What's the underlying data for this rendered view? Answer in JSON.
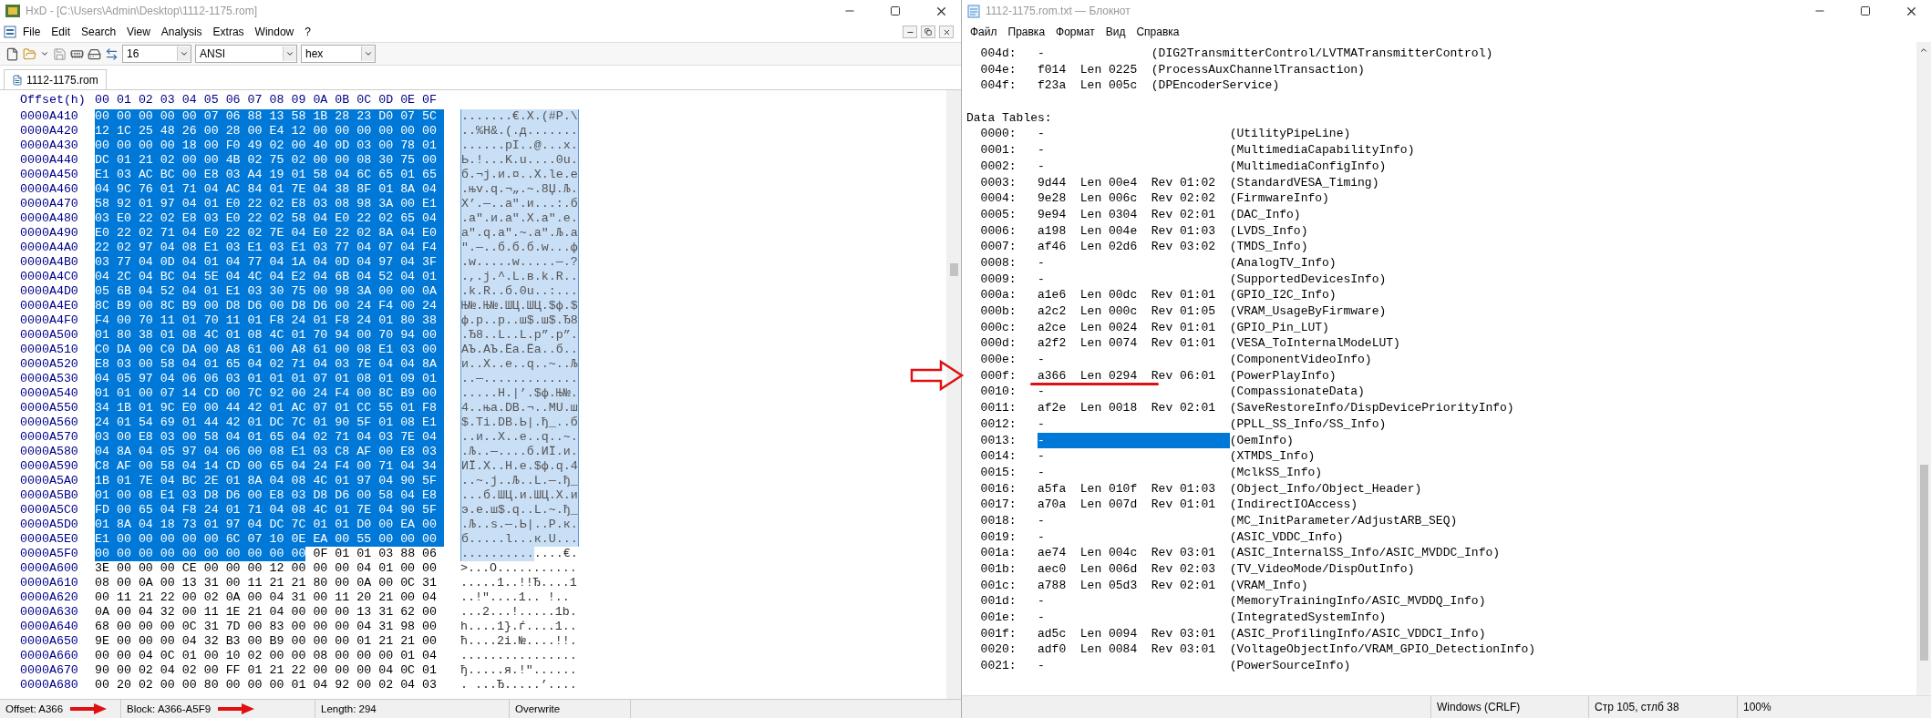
{
  "hex_editor": {
    "title": "HxD - [C:\\Users\\Admin\\Desktop\\1112-1175.rom]",
    "menu": [
      "File",
      "Edit",
      "Search",
      "View",
      "Analysis",
      "Extras",
      "Window",
      "?"
    ],
    "toolbar_selects": [
      "16",
      "ANSI",
      "hex"
    ],
    "tabs": [
      {
        "label": "1112-1175.rom",
        "selected": true
      }
    ],
    "offset_header": "Offset(h)",
    "columns": [
      "00",
      "01",
      "02",
      "03",
      "04",
      "05",
      "06",
      "07",
      "08",
      "09",
      "0A",
      "0B",
      "0C",
      "0D",
      "0E",
      "0F"
    ],
    "rows": [
      {
        "offset": "0000A410",
        "selected_hex": "00 00 00 00 00 07 06 88 13 58 1B 28 23 D0 07 5C",
        "selected_ascii": ".......€.X.(#Р.\\"
      },
      {
        "offset": "0000A420",
        "selected_hex": "12 1C 25 48 26 00 28 00 E4 12 00 00 00 00 00 00",
        "selected_ascii": "..%H&.(.д......."
      },
      {
        "offset": "0000A430",
        "selected_hex": "00 00 00 00 18 00 F0 49 02 00 40 0D 03 00 78 01",
        "selected_ascii": "......рI..@...x."
      },
      {
        "offset": "0000A440",
        "selected_hex": "DC 01 21 02 00 00 4B 02 75 02 00 00 08 30 75 00",
        "selected_ascii": "Ь.!...K.u....0u."
      },
      {
        "offset": "0000A450",
        "selected_hex": "E1 03 AC BC 00 E8 03 A4 19 01 58 04 6C 65 01 65",
        "selected_ascii": "б.¬ј.и.¤..X.le.e"
      },
      {
        "offset": "0000A460",
        "selected_hex": "04 9C 76 01 71 04 AC 84 01 7E 04 38 8F 01 8A 04",
        "selected_ascii": ".њv.q.¬„.~.8Џ.Љ."
      },
      {
        "offset": "0000A470",
        "selected_hex": "58 92 01 97 04 01 E0 22 02 E8 03 08 98 3A 00 E1",
        "selected_ascii": "X’.—..а\".и...:.б"
      },
      {
        "offset": "0000A480",
        "selected_hex": "03 E0 22 02 E8 03 E0 22 02 58 04 E0 22 02 65 04",
        "selected_ascii": ".а\".и.а\".X.а\".e."
      },
      {
        "offset": "0000A490",
        "selected_hex": "E0 22 02 71 04 E0 22 02 7E 04 E0 22 02 8A 04 E0",
        "selected_ascii": "а\".q.а\".~.а\".Љ.а"
      },
      {
        "offset": "0000A4A0",
        "selected_hex": "22 02 97 04 08 E1 03 E1 03 E1 03 77 04 07 04 F4",
        "selected_ascii": "\".—..б.б.б.w...ф"
      },
      {
        "offset": "0000A4B0",
        "selected_hex": "03 77 04 0D 04 01 04 77 04 1A 04 0D 04 97 04 3F",
        "selected_ascii": ".w.....w.....—.?"
      },
      {
        "offset": "0000A4C0",
        "selected_hex": "04 2C 04 BC 04 5E 04 4C 04 E2 04 6B 04 52 04 01",
        "selected_ascii": ".,.ј.^.L.в.k.R.."
      },
      {
        "offset": "0000A4D0",
        "selected_hex": "05 6B 04 52 04 01 E1 03 30 75 00 98 3A 00 00 0A",
        "selected_ascii": ".k.R..б.0u..:..."
      },
      {
        "offset": "0000A4E0",
        "selected_hex": "8C B9 00 8C B9 00 D8 D6 00 D8 D6 00 24 F4 00 24",
        "selected_ascii": "Њ№.Њ№.ШЦ.ШЦ.$ф.$"
      },
      {
        "offset": "0000A4F0",
        "selected_hex": "F4 00 70 11 01 70 11 01 F8 24 01 F8 24 01 80 38",
        "selected_ascii": "ф.p..p..ш$.ш$.Ђ8"
      },
      {
        "offset": "0000A500",
        "selected_hex": "01 80 38 01 08 4C 01 08 4C 01 70 94 00 70 94 00",
        "selected_ascii": ".Ђ8..L..L.p”.p”."
      },
      {
        "offset": "0000A510",
        "selected_hex": "C0 DA 00 C0 DA 00 A8 61 00 A8 61 00 08 E1 03 00",
        "selected_ascii": "АЪ.АЪ.Ёa.Ёa..б.."
      },
      {
        "offset": "0000A520",
        "selected_hex": "E8 03 00 58 04 01 65 04 02 71 04 03 7E 04 04 8A",
        "selected_ascii": "и..X..e..q..~..Љ"
      },
      {
        "offset": "0000A530",
        "selected_hex": "04 05 97 04 06 06 03 01 01 01 07 01 08 01 09 01",
        "selected_ascii": "..—............."
      },
      {
        "offset": "0000A540",
        "selected_hex": "01 01 00 07 14 CD 00 7C 92 00 24 F4 00 8C B9 00",
        "selected_ascii": ".....Н.|’.$ф.Њ№."
      },
      {
        "offset": "0000A550",
        "selected_hex": "34 1B 01 9C E0 00 44 42 01 AC 07 01 CC 55 01 F8",
        "selected_ascii": "4..ња.DB.¬..МU.ш"
      },
      {
        "offset": "0000A560",
        "selected_hex": "24 01 54 69 01 44 42 01 DC 7C 01 90 5F 01 08 E1",
        "selected_ascii": "$.Ti.DB.Ь|.ђ_..б"
      },
      {
        "offset": "0000A570",
        "selected_hex": "03 00 E8 03 00 58 04 01 65 04 02 71 04 03 7E 04",
        "selected_ascii": "..и..X..e..q..~."
      },
      {
        "offset": "0000A580",
        "selected_hex": "04 8A 04 05 97 04 06 00 08 E1 03 C8 AF 00 E8 03",
        "selected_ascii": ".Љ..—....б.ИЇ.и."
      },
      {
        "offset": "0000A590",
        "selected_hex": "C8 AF 00 58 04 14 CD 00 65 04 24 F4 00 71 04 34",
        "selected_ascii": "ИЇ.X..Н.e.$ф.q.4"
      },
      {
        "offset": "0000A5A0",
        "selected_hex": "1B 01 7E 04 BC 2E 01 8A 04 08 4C 01 97 04 90 5F",
        "selected_ascii": "..~.ј..Љ..L.—.ђ_"
      },
      {
        "offset": "0000A5B0",
        "selected_hex": "01 00 08 E1 03 D8 D6 00 E8 03 D8 D6 00 58 04 E8",
        "selected_ascii": "...б.ШЦ.и.ШЦ.X.и"
      },
      {
        "offset": "0000A5C0",
        "selected_hex": "FD 00 65 04 F8 24 01 71 04 08 4C 01 7E 04 90 5F",
        "selected_ascii": "э.e.ш$.q..L.~.ђ_"
      },
      {
        "offset": "0000A5D0",
        "selected_hex": "01 8A 04 18 73 01 97 04 DC 7C 01 01 D0 00 EA 00",
        "selected_ascii": ".Љ..s.—.Ь|..Р.к."
      },
      {
        "offset": "0000A5E0",
        "selected_hex": "E1 00 00 00 00 00 6C 07 10 0E EA 00 55 00 00 00",
        "selected_ascii": "б.....l...к.U..."
      },
      {
        "offset": "0000A5F0",
        "selected_hex": "00 00 00 00 00 00 00 00 00 00",
        "hex": "0F 01 01 03 88 06",
        "selected_ascii": "..........",
        "ascii": "....€."
      },
      {
        "offset": "0000A600",
        "hex": "3E 00 00 00 CE 00 00 00 12 00 00 00 04 01 00 00",
        "ascii": ">...О..........."
      },
      {
        "offset": "0000A610",
        "hex": "08 00 0A 00 13 31 00 11 21 21 80 00 0A 00 0C 31",
        "ascii": ".....1..!!Ђ....1"
      },
      {
        "offset": "0000A620",
        "hex": "00 11 21 22 00 02 0A 00 04 31 00 11 20 21 00 04",
        "ascii": "..!\"....1.. !.."
      },
      {
        "offset": "0000A630",
        "hex": "0A 00 04 32 00 11 1E 21 04 00 00 00 13 31 62 00",
        "ascii": "...2...!.....1b."
      },
      {
        "offset": "0000A640",
        "hex": "68 00 00 00 0C 31 7D 00 83 00 00 00 04 31 98 00",
        "ascii": "h....1}.ѓ....1.."
      },
      {
        "offset": "0000A650",
        "hex": "9E 00 00 00 04 32 B3 00 B9 00 00 00 01 21 21 00",
        "ascii": "ћ....2і.№....!!."
      },
      {
        "offset": "0000A660",
        "hex": "00 00 04 0C 01 00 10 02 00 00 08 00 00 00 01 04",
        "ascii": "................"
      },
      {
        "offset": "0000A670",
        "hex": "90 00 02 04 02 00 FF 01 21 22 00 00 00 04 0C 01",
        "ascii": "ђ.....я.!\"......"
      },
      {
        "offset": "0000A680",
        "hex": "00 20 02 00 00 80 00 00 00 01 04 92 00 02 04 03",
        "ascii": ". ...Ђ.....’...."
      }
    ],
    "status": [
      {
        "text": "Offset: A366",
        "annotated": true
      },
      {
        "text": "Block: A366-A5F9",
        "annotated": true
      },
      {
        "text": "Length: 294",
        "annotated": false
      },
      {
        "text": "Overwrite",
        "annotated": false
      }
    ]
  },
  "notepad": {
    "title": "1112-1175.rom.txt — Блокнот",
    "menu": [
      "Файл",
      "Правка",
      "Формат",
      "Вид",
      "Справка"
    ],
    "blocks": [
      {
        "kind": "functions",
        "rows": [
          {
            "id": "004d:",
            "addr": "-",
            "name": "(DIG2TransmitterControl/LVTMATransmitterControl)"
          },
          {
            "id": "004e:",
            "addr": "f014",
            "length": "Len 0225",
            "name": "(ProcessAuxChannelTransaction)"
          },
          {
            "id": "004f:",
            "addr": "f23a",
            "length": "Len 005c",
            "name": "(DPEncoderService)"
          }
        ]
      },
      {
        "kind": "tables",
        "heading": "Data Tables:",
        "rows": [
          {
            "id": "0000:",
            "addr": "-",
            "name": "(UtilityPipeLine)",
            "highlighted": false,
            "marked": false
          },
          {
            "id": "0001:",
            "addr": "-",
            "name": "(MultimediaCapabilityInfo)",
            "highlighted": false,
            "marked": false
          },
          {
            "id": "0002:",
            "addr": "-",
            "name": "(MultimediaConfigInfo)",
            "highlighted": false,
            "marked": false
          },
          {
            "id": "0003:",
            "addr": "9d44",
            "length": "Len 00e4",
            "rev": "Rev 01:02",
            "name": "(StandardVESA_Timing)",
            "highlighted": false,
            "marked": false
          },
          {
            "id": "0004:",
            "addr": "9e28",
            "length": "Len 006c",
            "rev": "Rev 02:02",
            "name": "(FirmwareInfo)",
            "highlighted": false,
            "marked": false
          },
          {
            "id": "0005:",
            "addr": "9e94",
            "length": "Len 0304",
            "rev": "Rev 02:01",
            "name": "(DAC_Info)",
            "highlighted": false,
            "marked": false
          },
          {
            "id": "0006:",
            "addr": "a198",
            "length": "Len 004e",
            "rev": "Rev 01:03",
            "name": "(LVDS_Info)",
            "highlighted": false,
            "marked": false
          },
          {
            "id": "0007:",
            "addr": "af46",
            "length": "Len 02d6",
            "rev": "Rev 03:02",
            "name": "(TMDS_Info)",
            "highlighted": false,
            "marked": false
          },
          {
            "id": "0008:",
            "addr": "-",
            "name": "(AnalogTV_Info)",
            "highlighted": false,
            "marked": false
          },
          {
            "id": "0009:",
            "addr": "-",
            "name": "(SupportedDevicesInfo)",
            "highlighted": false,
            "marked": false
          },
          {
            "id": "000a:",
            "addr": "a1e6",
            "length": "Len 00dc",
            "rev": "Rev 01:01",
            "name": "(GPIO_I2C_Info)",
            "highlighted": false,
            "marked": false
          },
          {
            "id": "000b:",
            "addr": "a2c2",
            "length": "Len 000c",
            "rev": "Rev 01:05",
            "name": "(VRAM_UsageByFirmware)",
            "highlighted": false,
            "marked": false
          },
          {
            "id": "000c:",
            "addr": "a2ce",
            "length": "Len 0024",
            "rev": "Rev 01:01",
            "name": "(GPIO_Pin_LUT)",
            "highlighted": false,
            "marked": false
          },
          {
            "id": "000d:",
            "addr": "a2f2",
            "length": "Len 0074",
            "rev": "Rev 01:01",
            "name": "(VESA_ToInternalModeLUT)",
            "highlighted": false,
            "marked": false
          },
          {
            "id": "000e:",
            "addr": "-",
            "name": "(ComponentVideoInfo)",
            "highlighted": false,
            "marked": false
          },
          {
            "id": "000f:",
            "addr": "a366",
            "length": "Len 0294",
            "rev": "Rev 06:01",
            "name": "(PowerPlayInfo)",
            "highlighted": false,
            "marked": true
          },
          {
            "id": "0010:",
            "addr": "-",
            "name": "(CompassionateData)",
            "highlighted": false,
            "marked": false
          },
          {
            "id": "0011:",
            "addr": "af2e",
            "length": "Len 0018",
            "rev": "Rev 02:01",
            "name": "(SaveRestoreInfo/DispDevicePriorityInfo)",
            "highlighted": false,
            "marked": false
          },
          {
            "id": "0012:",
            "addr": "-",
            "name": "(PPLL_SS_Info/SS_Info)",
            "highlighted": false,
            "marked": false
          },
          {
            "id": "0013:",
            "addr": "-",
            "name": "(OemInfo)",
            "highlighted": true,
            "marked": false
          },
          {
            "id": "0014:",
            "addr": "-",
            "name": "(XTMDS_Info)",
            "highlighted": false,
            "marked": false
          },
          {
            "id": "0015:",
            "addr": "-",
            "name": "(MclkSS_Info)",
            "highlighted": false,
            "marked": false
          },
          {
            "id": "0016:",
            "addr": "a5fa",
            "length": "Len 010f",
            "rev": "Rev 01:03",
            "name": "(Object_Info/Object_Header)",
            "highlighted": false,
            "marked": false
          },
          {
            "id": "0017:",
            "addr": "a70a",
            "length": "Len 007d",
            "rev": "Rev 01:01",
            "name": "(IndirectIOAccess)",
            "highlighted": false,
            "marked": false
          },
          {
            "id": "0018:",
            "addr": "-",
            "name": "(MC_InitParameter/AdjustARB_SEQ)",
            "highlighted": false,
            "marked": false
          },
          {
            "id": "0019:",
            "addr": "-",
            "name": "(ASIC_VDDC_Info)",
            "highlighted": false,
            "marked": false
          },
          {
            "id": "001a:",
            "addr": "ae74",
            "length": "Len 004c",
            "rev": "Rev 03:01",
            "name": "(ASIC_InternalSS_Info/ASIC_MVDDC_Info)",
            "highlighted": false,
            "marked": false
          },
          {
            "id": "001b:",
            "addr": "aec0",
            "length": "Len 006d",
            "rev": "Rev 02:03",
            "name": "(TV_VideoMode/DispOutInfo)",
            "highlighted": false,
            "marked": false
          },
          {
            "id": "001c:",
            "addr": "a788",
            "length": "Len 05d3",
            "rev": "Rev 02:01",
            "name": "(VRAM_Info)",
            "highlighted": false,
            "marked": false
          },
          {
            "id": "001d:",
            "addr": "-",
            "name": "(MemoryTrainingInfo/ASIC_MVDDQ_Info)",
            "highlighted": false,
            "marked": false
          },
          {
            "id": "001e:",
            "addr": "-",
            "name": "(IntegratedSystemInfo)",
            "highlighted": false,
            "marked": false
          },
          {
            "id": "001f:",
            "addr": "ad5c",
            "length": "Len 0094",
            "rev": "Rev 03:01",
            "name": "(ASIC_ProfilingInfo/ASIC_VDDCI_Info)",
            "highlighted": false,
            "marked": false
          },
          {
            "id": "0020:",
            "addr": "adf0",
            "length": "Len 0084",
            "rev": "Rev 03:01",
            "name": "(VoltageObjectInfo/VRAM_GPIO_DetectionInfo)",
            "highlighted": false,
            "marked": false
          },
          {
            "id": "0021:",
            "addr": "-",
            "name": "(PowerSourceInfo)",
            "highlighted": false,
            "marked": false
          }
        ]
      }
    ],
    "status": [
      "Windows (CRLF)",
      "Стр 105, стлб 38",
      "100%"
    ]
  }
}
